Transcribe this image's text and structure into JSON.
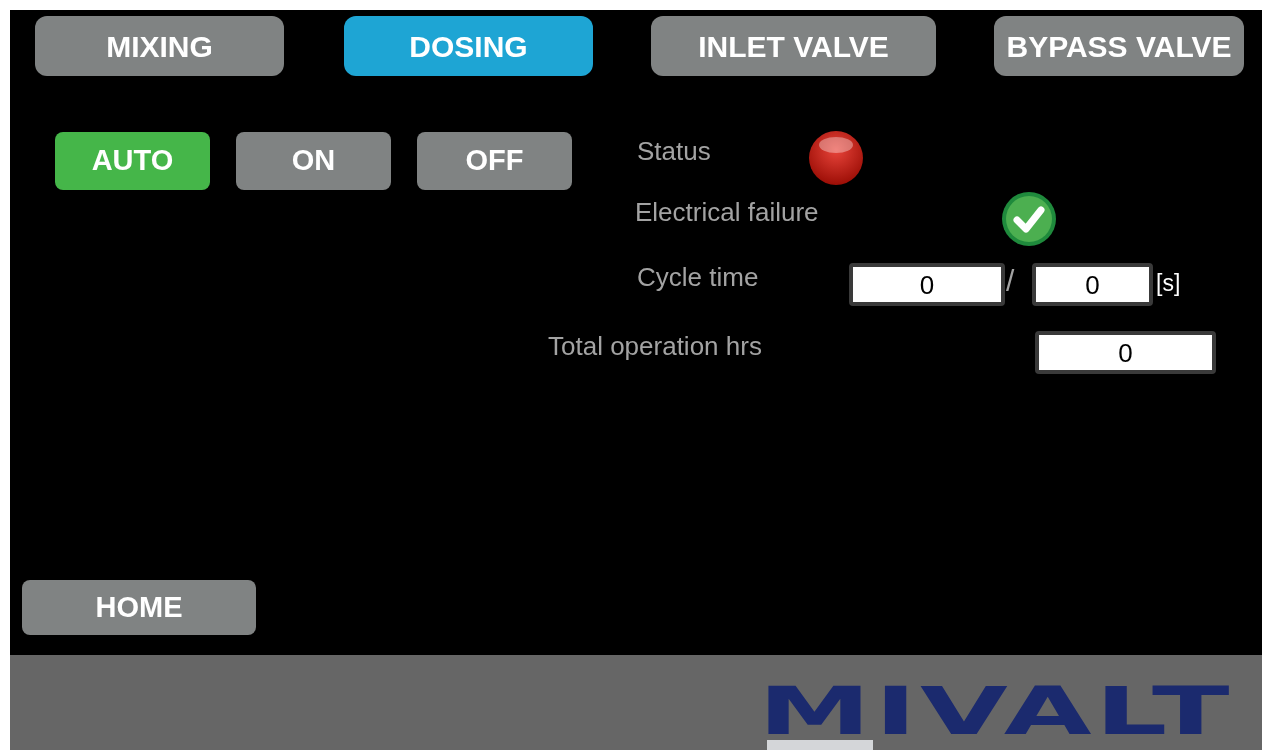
{
  "tabs": [
    {
      "label": "MIXING",
      "selected": false
    },
    {
      "label": "DOSING",
      "selected": true
    },
    {
      "label": "INLET VALVE",
      "selected": false
    },
    {
      "label": "BYPASS VALVE",
      "selected": false
    }
  ],
  "modes": [
    {
      "label": "AUTO",
      "selected": true
    },
    {
      "label": "ON",
      "selected": false
    },
    {
      "label": "OFF",
      "selected": false
    }
  ],
  "indicators": [
    {
      "label": "Status",
      "ok": false
    },
    {
      "label": "Electrical failure",
      "ok": true
    }
  ],
  "cycle_time": {
    "label": "Cycle time",
    "value": "0",
    "setpoint": "0",
    "unit": "[s]",
    "separator": "/"
  },
  "total_hours": {
    "label": "Total operation hrs",
    "value": "0"
  },
  "home_button": "HOME",
  "logo": "MIVALT"
}
